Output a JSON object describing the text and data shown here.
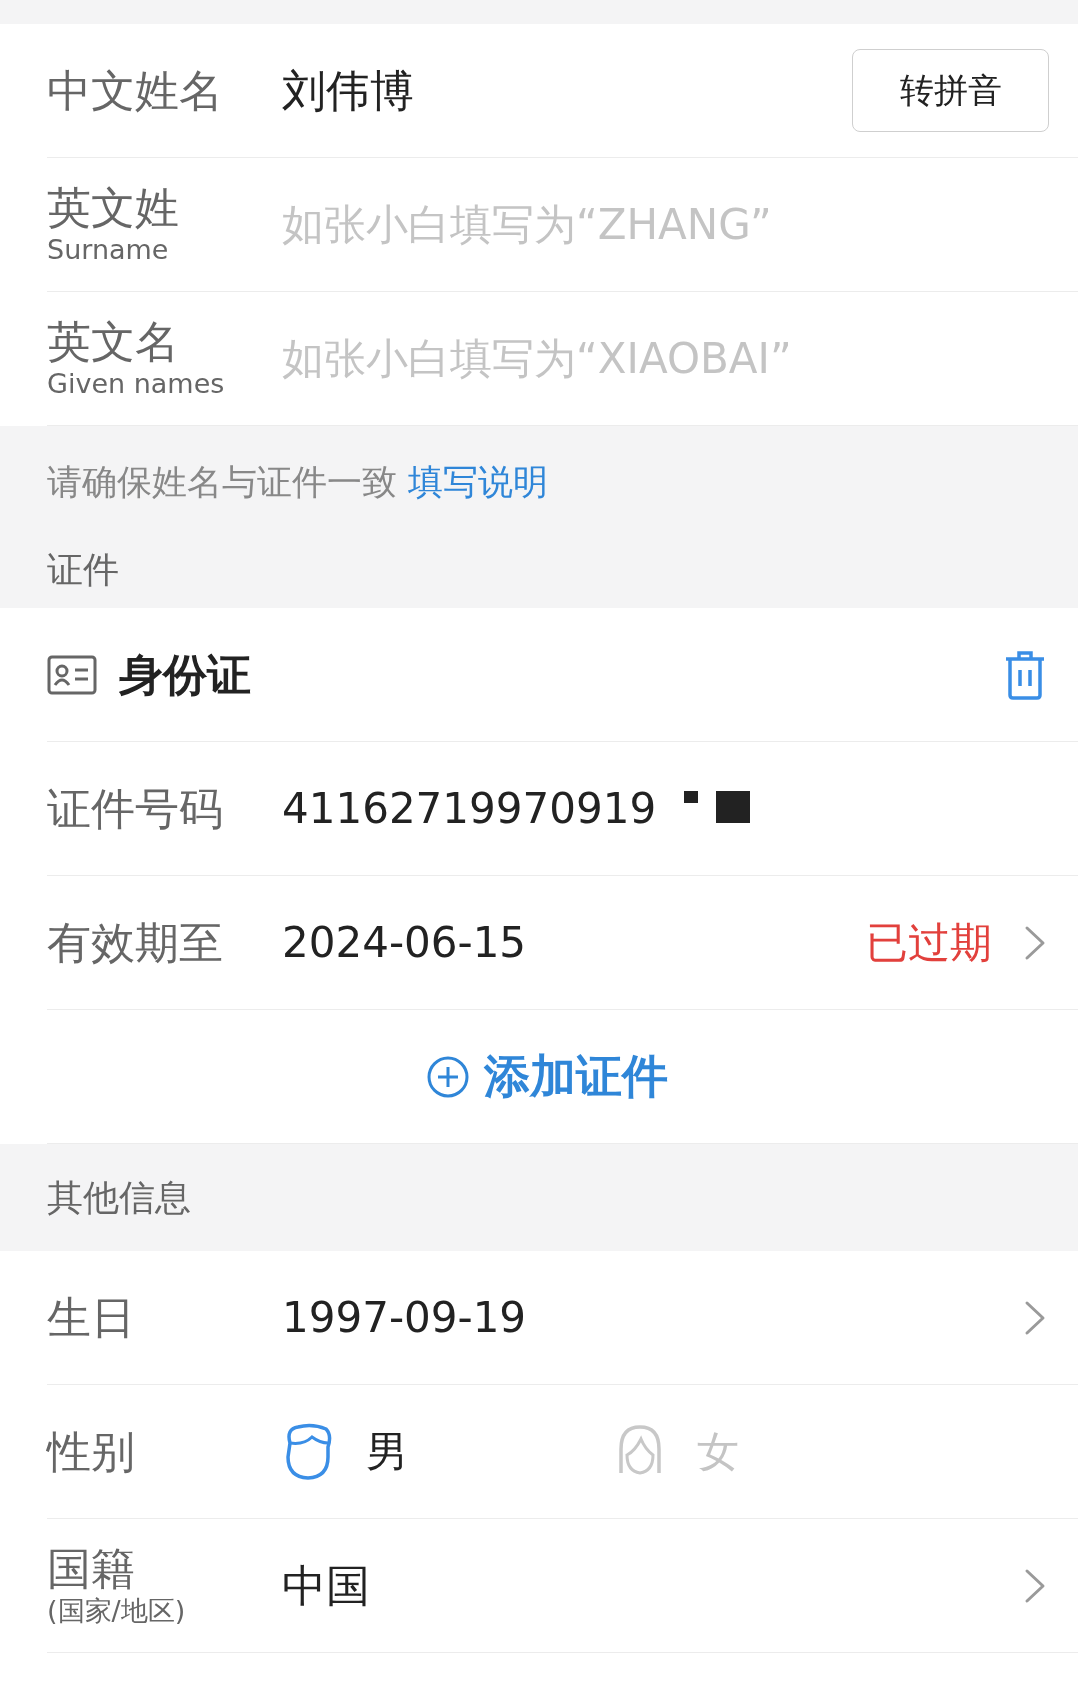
{
  "chinese_name": {
    "label": "中文姓名",
    "value": "刘伟博",
    "button": "转拼音"
  },
  "english_fields": [
    {
      "label": "英文姓",
      "sublabel": "Surname",
      "placeholder": "如张小白填写为“ZHANG”"
    },
    {
      "label": "英文名",
      "sublabel": "Given names",
      "placeholder": "如张小白填写为“XIAOBAI”"
    }
  ],
  "name_note": {
    "text": "请确保姓名与证件一致",
    "link": "填写说明"
  },
  "document_section": {
    "title": "证件"
  },
  "document": {
    "type": "身份证",
    "number_label": "证件号码",
    "number": "41162719970919",
    "expiry_label": "有效期至",
    "expiry": "2024-06-15",
    "status": "已过期",
    "expired": true
  },
  "add_document": "添加证件",
  "other_section": {
    "title": "其他信息"
  },
  "birthday": {
    "label": "生日",
    "value": "1997-09-19"
  },
  "gender": {
    "label": "性别",
    "options": [
      {
        "label": "男",
        "kind": "male",
        "selected": true
      },
      {
        "label": "女",
        "kind": "female",
        "selected": false
      }
    ]
  },
  "nationality": {
    "label": "国籍",
    "sublabel": "(国家/地区)",
    "value": "中国"
  }
}
